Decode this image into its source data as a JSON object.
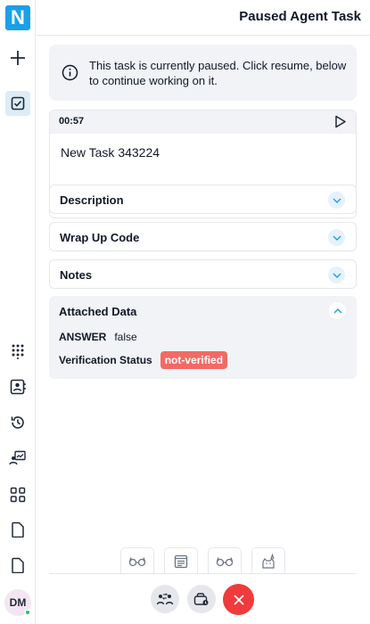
{
  "app": {
    "logo_letter": "N",
    "brand_color": "#1aa0e8"
  },
  "header": {
    "title": "Paused Agent Task"
  },
  "sidebar": {
    "top_items": [
      {
        "icon": "plus-icon"
      },
      {
        "icon": "task-checkbox-icon",
        "active": true
      }
    ],
    "bottom_items": [
      {
        "icon": "dialpad-icon"
      },
      {
        "icon": "contacts-icon"
      },
      {
        "icon": "history-icon"
      },
      {
        "icon": "agent-stats-icon"
      },
      {
        "icon": "apps-grid-icon"
      },
      {
        "icon": "document-icon"
      },
      {
        "icon": "document-icon"
      }
    ],
    "user_initials": "DM",
    "presence_color": "#22c55e"
  },
  "banner": {
    "text": "This task is currently paused. Click resume, below to continue working on it."
  },
  "task": {
    "timer": "00:57",
    "name": "New Task 343224"
  },
  "sections": [
    {
      "label": "Description",
      "expanded": false
    },
    {
      "label": "Wrap Up Code",
      "expanded": false
    },
    {
      "label": "Notes",
      "expanded": false
    }
  ],
  "attached": {
    "label": "Attached Data",
    "expanded": true,
    "fields": [
      {
        "key": "ANSWER",
        "value": "false"
      },
      {
        "key": "Verification Status",
        "value": "not-verified",
        "badge_color": "#f26a64"
      }
    ]
  },
  "toolbar": {
    "tools": [
      "glasses-icon",
      "notes-icon",
      "glasses-icon",
      "cat-icon"
    ]
  },
  "call_controls": [
    "transfer-icon",
    "hold-icon",
    "end-call-icon"
  ]
}
